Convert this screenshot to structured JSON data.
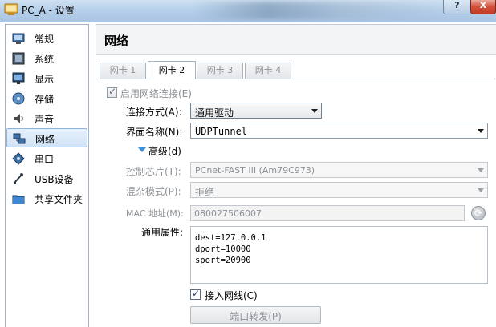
{
  "window": {
    "title": "PC_A - 设置",
    "help_label": "?",
    "close_label": "x"
  },
  "sidebar": {
    "items": [
      {
        "label": "常规",
        "icon": "general-icon"
      },
      {
        "label": "系统",
        "icon": "system-icon"
      },
      {
        "label": "显示",
        "icon": "display-icon"
      },
      {
        "label": "存储",
        "icon": "storage-icon"
      },
      {
        "label": "声音",
        "icon": "audio-icon"
      },
      {
        "label": "网络",
        "icon": "network-icon",
        "selected": true
      },
      {
        "label": "串口",
        "icon": "serial-port-icon"
      },
      {
        "label": "USB设备",
        "icon": "usb-icon"
      },
      {
        "label": "共享文件夹",
        "icon": "shared-folder-icon"
      }
    ]
  },
  "main": {
    "title": "网络",
    "tabs": [
      {
        "label": "网卡 1",
        "active": false
      },
      {
        "label": "网卡 2",
        "active": true
      },
      {
        "label": "网卡 3",
        "active": false
      },
      {
        "label": "网卡 4",
        "active": false
      }
    ]
  },
  "adapter": {
    "enable_label": "启用网络连接(E)",
    "enable_checked": true,
    "attached_to_label": "连接方式(A):",
    "attached_to_value": "通用驱动",
    "name_label": "界面名称(N):",
    "name_value": "UDPTunnel",
    "advanced_label": "高级(d)",
    "chip_label": "控制芯片(T):",
    "chip_value": "PCnet-FAST III (Am79C973)",
    "promisc_label": "混杂模式(P):",
    "promisc_value": "拒绝",
    "mac_label": "MAC 地址(M):",
    "mac_value": "080027506007",
    "generic_props_label": "通用属性:",
    "generic_props_lines": [
      "dest=127.0.0.1",
      "dport=10000",
      "sport=20900"
    ],
    "cable_connected_label": "接入网线(C)",
    "cable_connected_checked": true,
    "port_forwarding_label": "端口转发(P)",
    "refresh_glyph": "⟳"
  },
  "colors": {
    "selection_bg": "#cfe2f7",
    "accent_triangle": "#3d8fd6",
    "disabled_text": "#8c9196",
    "close_button": "#c23c25"
  }
}
